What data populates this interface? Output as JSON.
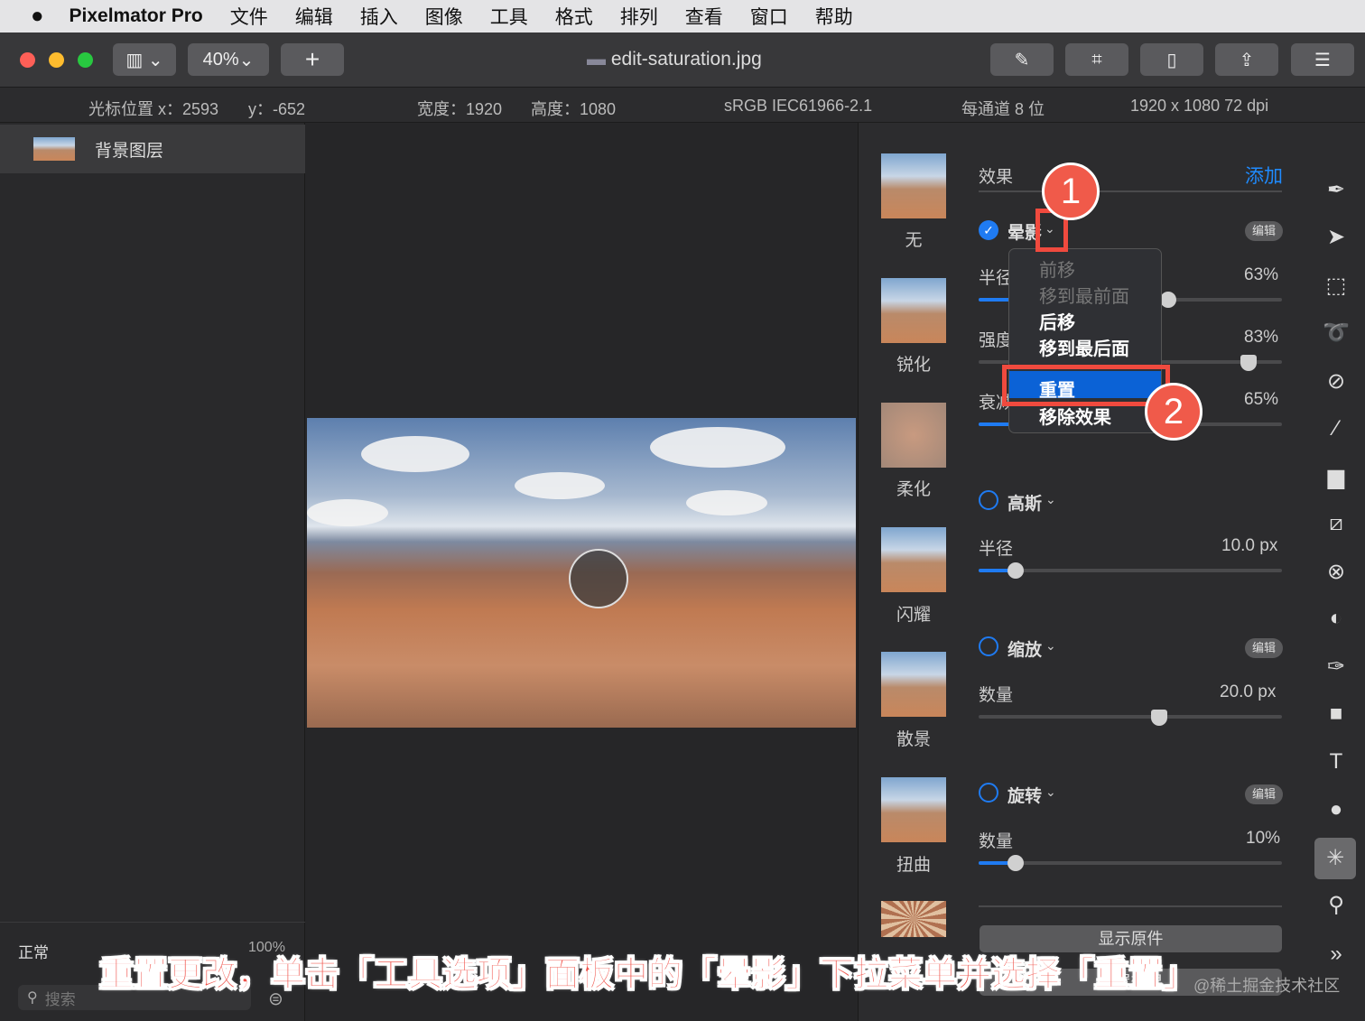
{
  "menubar": {
    "app": "Pixelmator Pro",
    "items": [
      "文件",
      "编辑",
      "插入",
      "图像",
      "工具",
      "格式",
      "排列",
      "查看",
      "窗口",
      "帮助"
    ]
  },
  "toolbar": {
    "zoom": "40%",
    "add": "+",
    "title": "edit-saturation.jpg"
  },
  "infobar": {
    "cursor_x": "光标位置 x：2593",
    "cursor_y": "y：-652",
    "width": "宽度：1920",
    "height": "高度：1080",
    "profile": "sRGB IEC61966-2.1",
    "depth": "每通道 8 位",
    "size": "1920 x 1080 72 dpi"
  },
  "layers": {
    "items": [
      {
        "name": "背景图层"
      }
    ],
    "blend": "正常",
    "opacity": "100%",
    "search_placeholder": "搜索"
  },
  "presets": [
    "无",
    "锐化",
    "柔化",
    "闪耀",
    "散景",
    "扭曲"
  ],
  "effects": {
    "header": "效果",
    "add": "添加",
    "edit": "编辑",
    "vignette": {
      "name": "晕影",
      "params": [
        {
          "label": "半径",
          "value": "63%",
          "level": 0.63
        },
        {
          "label": "强度",
          "value": "83%",
          "level": 0.83
        },
        {
          "label": "衰减",
          "value": "65%",
          "level": 0.65
        }
      ]
    },
    "gaussian": {
      "name": "高斯",
      "label": "半径",
      "value": "10.0 px",
      "level": 0.12
    },
    "zoom": {
      "name": "缩放",
      "label": "数量",
      "value": "20.0 px",
      "level": 0.59
    },
    "twirl": {
      "name": "旋转",
      "label": "数量",
      "value": "10%",
      "level": 0.12
    },
    "show_original": "显示原件",
    "reset_effects": "重置效果"
  },
  "context_menu": {
    "items": [
      {
        "label": "前移",
        "enabled": false
      },
      {
        "label": "移到最前面",
        "enabled": false
      },
      {
        "label": "后移",
        "enabled": true
      },
      {
        "label": "移到最后面",
        "enabled": true
      },
      {
        "label": "重置",
        "enabled": true,
        "selected": true
      },
      {
        "label": "移除效果",
        "enabled": true
      }
    ]
  },
  "callouts": [
    "1",
    "2"
  ],
  "caption": "重置更改，单击「工具选项」面板中的「晕影」下拉菜单并选择「重置」",
  "watermark": "@稀土掘金技术社区",
  "colors": {
    "accent": "#1f7bf2",
    "callout": "#f05a4a"
  }
}
